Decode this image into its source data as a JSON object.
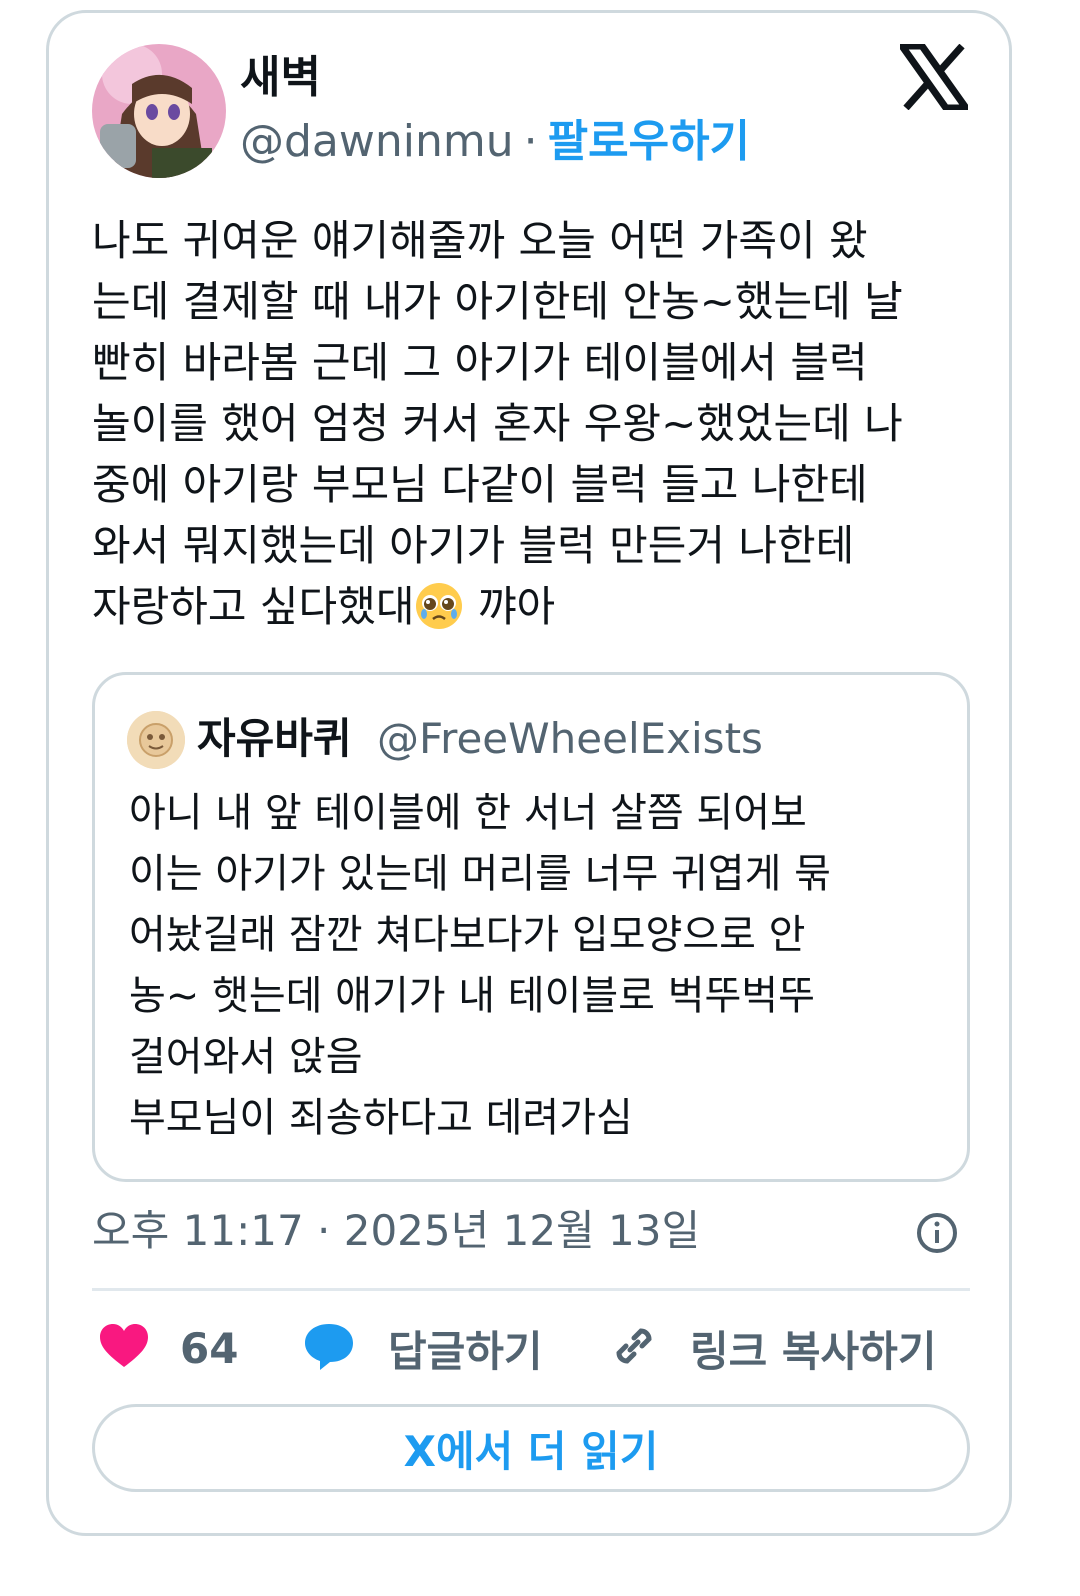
{
  "author": {
    "display_name": "새벽",
    "handle": "@dawninmu",
    "separator": "·",
    "follow_label": "팔로우하기"
  },
  "post": {
    "text": "나도 귀여운 얘기해줄까 오늘 어떤 가족이 왔\n는데 결제할 때 내가 아기한테 안농~했는데 날\n빤히 바라봄 근데 그 아기가 테이블에서 블럭\n놀이를 했어 엄청 커서 혼자 우왕~했었는데 나\n중에 아기랑 부모님 다같이 블럭 들고 나한테\n와서 뭐지했는데 아기가 블럭 만든거 나한테\n자랑하고 싶다했대",
    "text_tail": " 꺄아",
    "emoji_name": "pleading-face-emoji"
  },
  "quote": {
    "display_name": "자유바퀴",
    "handle": "@FreeWheelExists",
    "text": "아니 내 앞 테이블에 한 서너 살쯤 되어보\n이는 아기가 있는데 머리를 너무 귀엽게 묶\n어놨길래 잠깐 쳐다보다가 입모양으로 안\n농~ 햇는데 애기가 내 테이블로 벅뚜벅뚜\n걸어와서 앉음\n부모님이 죄송하다고 데려가심"
  },
  "meta": {
    "timestamp": "오후 11:17 · 2025년 12월 13일"
  },
  "actions": {
    "like_count": "64",
    "reply_label": "답글하기",
    "copy_link_label": "링크 복사하기"
  },
  "read_more_label": "X에서 더 읽기",
  "colors": {
    "accent": "#1d9bf0",
    "like": "#f91880",
    "muted": "#536471",
    "border": "#cfd9de"
  }
}
